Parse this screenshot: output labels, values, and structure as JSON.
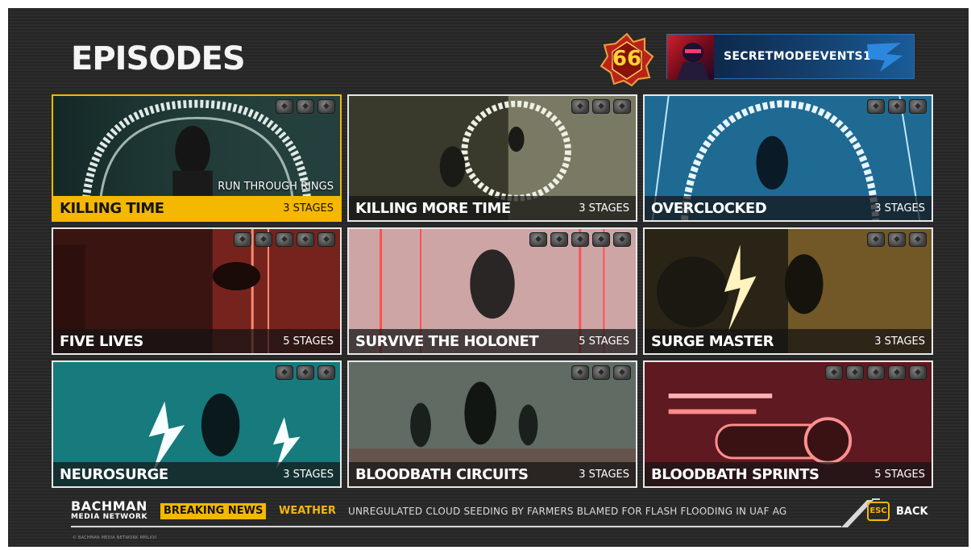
{
  "header": {
    "title": "EPISODES",
    "level": "66",
    "player_name": "SECRETMODEEVENTS1"
  },
  "colors": {
    "accent": "#f5b800",
    "card_border": "#e8e8e8",
    "background": "#282828"
  },
  "icons": {
    "medal": "medal-icon",
    "level": "level-badge-icon",
    "emblem": "player-emblem-icon",
    "esc": "esc-key-icon"
  },
  "episodes": [
    {
      "name": "KILLING TIME",
      "stages": "3 STAGES",
      "subtitle": "RUN THROUGH RINGS",
      "medals": 3,
      "selected": true,
      "theme": "teal-rings"
    },
    {
      "name": "KILLING MORE TIME",
      "stages": "3 STAGES",
      "subtitle": "",
      "medals": 3,
      "selected": false,
      "theme": "street-ring"
    },
    {
      "name": "OVERCLOCKED",
      "stages": "3 STAGES",
      "subtitle": "",
      "medals": 3,
      "selected": false,
      "theme": "blue-neon"
    },
    {
      "name": "FIVE LIVES",
      "stages": "5 STAGES",
      "subtitle": "",
      "medals": 5,
      "selected": false,
      "theme": "red-lab"
    },
    {
      "name": "SURVIVE THE HOLONET",
      "stages": "5 STAGES",
      "subtitle": "",
      "medals": 5,
      "selected": false,
      "theme": "white-red"
    },
    {
      "name": "SURGE MASTER",
      "stages": "3 STAGES",
      "subtitle": "",
      "medals": 3,
      "selected": false,
      "theme": "gold-surge"
    },
    {
      "name": "NEUROSURGE",
      "stages": "3 STAGES",
      "subtitle": "",
      "medals": 3,
      "selected": false,
      "theme": "cyan-surge"
    },
    {
      "name": "BLOODBATH CIRCUITS",
      "stages": "3 STAGES",
      "subtitle": "",
      "medals": 3,
      "selected": false,
      "theme": "fog-grid"
    },
    {
      "name": "BLOODBATH SPRINTS",
      "stages": "5 STAGES",
      "subtitle": "",
      "medals": 5,
      "selected": false,
      "theme": "red-roller"
    }
  ],
  "ticker": {
    "brand_line1": "BACHMAN",
    "brand_line2": "MEDIA NETWORK",
    "breaking": "BREAKING NEWS",
    "category": "WEATHER",
    "headline": "UNREGULATED CLOUD SEEDING BY FARMERS BLAMED FOR FLASH FLOODING IN UAF AG"
  },
  "footer": {
    "esc_key": "ESC",
    "back_label": "BACK",
    "copyright": "© BACHMAN MEDIA NETWORK MMLXVI"
  }
}
